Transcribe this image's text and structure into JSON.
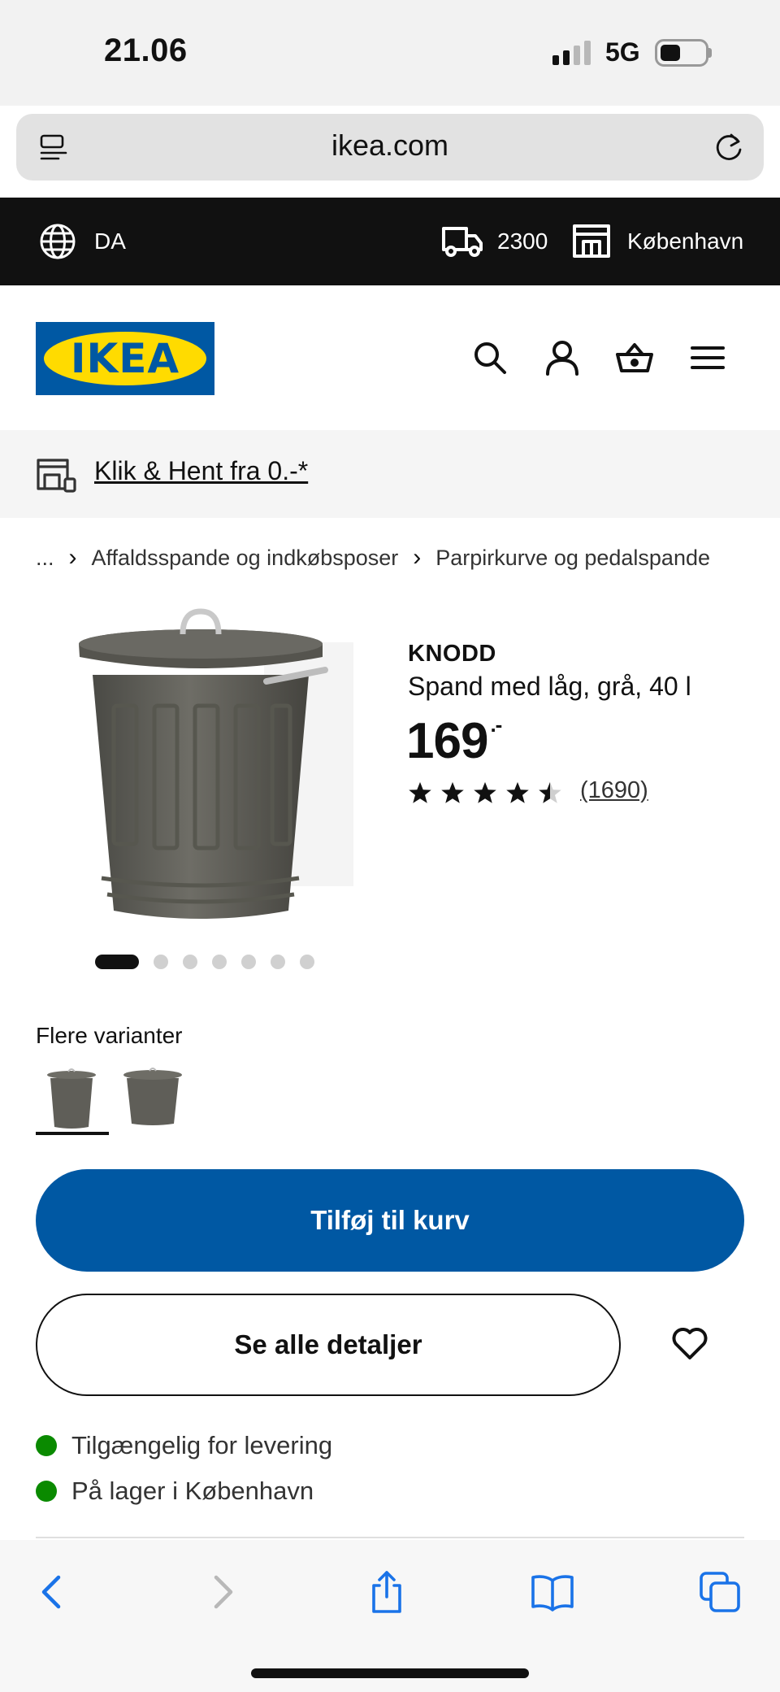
{
  "status_bar": {
    "time": "21.06",
    "network": "5G"
  },
  "browser": {
    "url": "ikea.com"
  },
  "top_strip": {
    "language": "DA",
    "postal_code": "2300",
    "store": "København"
  },
  "header": {
    "logo_text": "IKEA",
    "icons": [
      "search-icon",
      "account-icon",
      "basket-icon",
      "menu-icon"
    ]
  },
  "promo": {
    "label": "Klik & Hent fra 0.-*"
  },
  "breadcrumb": {
    "items": [
      "...",
      "Affaldsspande og indkøbsposer",
      "Parpirkurve og pedalspande"
    ]
  },
  "product": {
    "name": "KNODD",
    "description": "Spand med låg, grå, 40 l",
    "price": "169",
    "price_suffix": ".-",
    "rating": 4.5,
    "review_count": "(1690)",
    "image_count": 7,
    "active_image": 0
  },
  "variants": {
    "label": "Flere varianter",
    "selected": 0
  },
  "actions": {
    "add_to_cart": "Tilføj til kurv",
    "see_details": "Se alle detaljer"
  },
  "availability": [
    {
      "text": "Tilgængelig for levering",
      "status_color": "#0a8a00"
    },
    {
      "text": "På lager i København",
      "status_color": "#0a8a00"
    }
  ],
  "colors": {
    "brand_blue": "#0058a3",
    "brand_yellow": "#ffdb00",
    "available_green": "#0a8a00"
  }
}
